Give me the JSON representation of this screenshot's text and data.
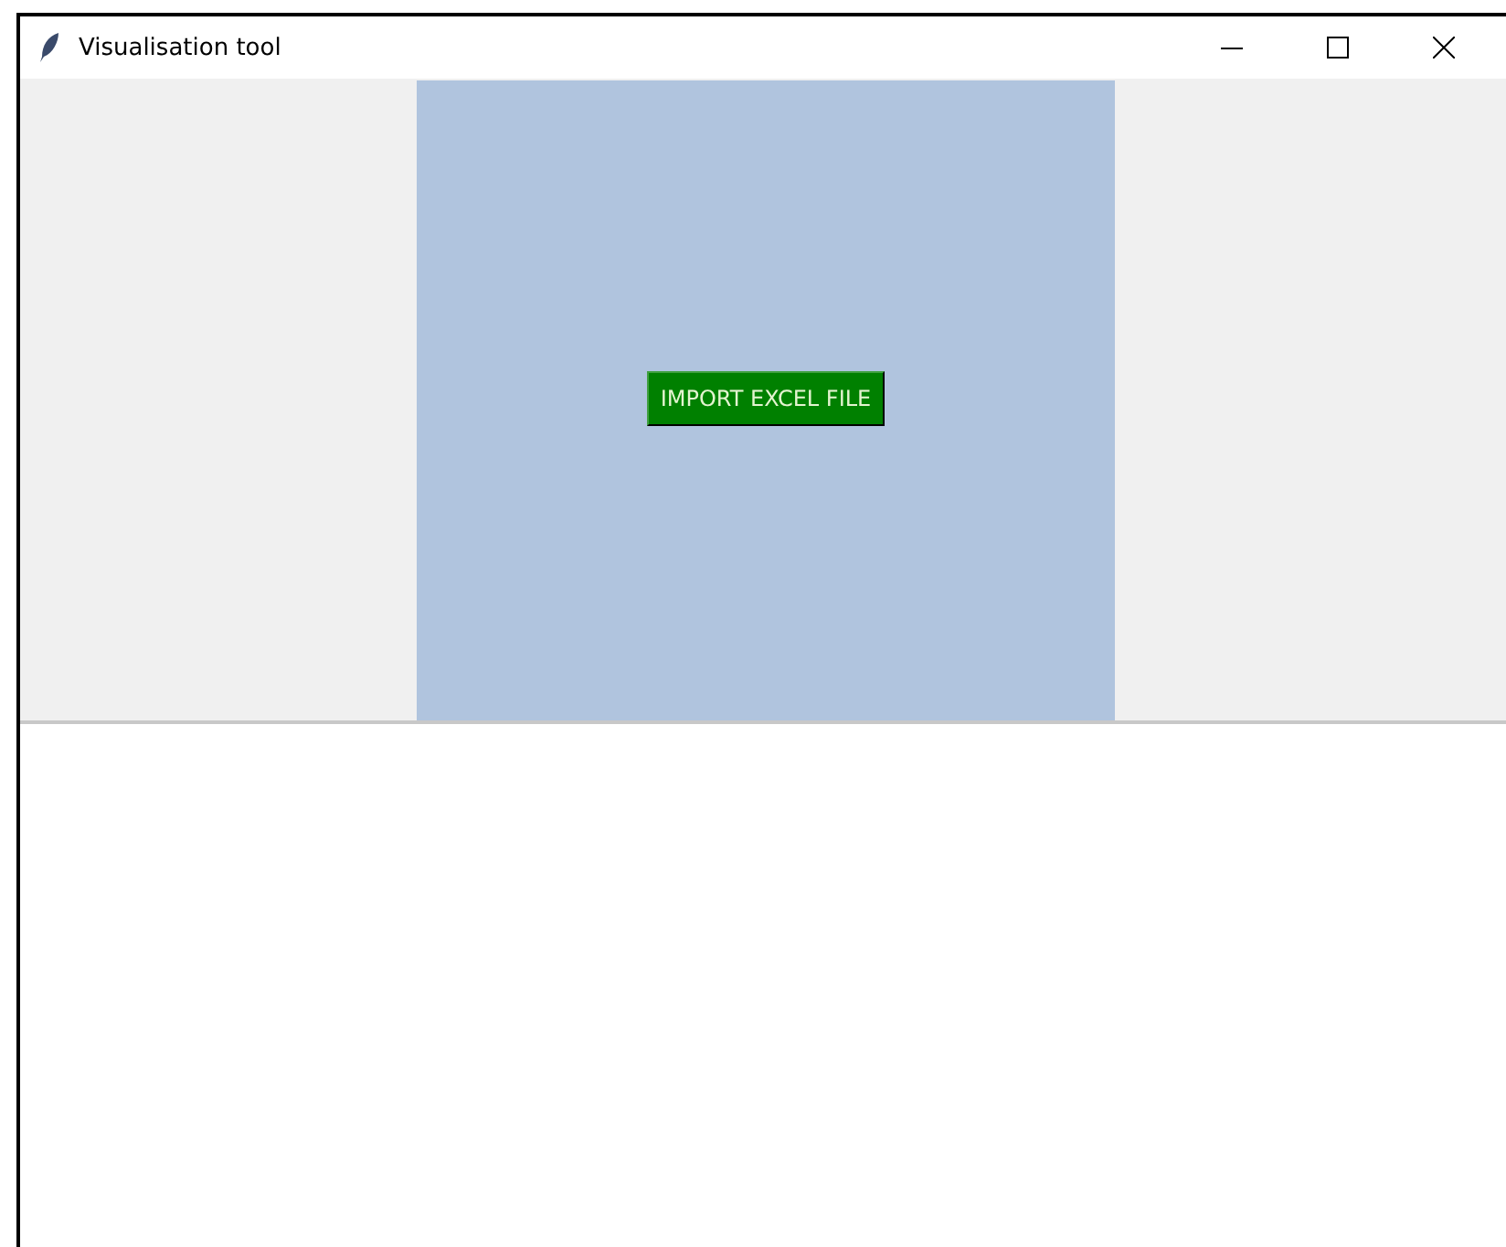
{
  "window": {
    "title": "Visualisation tool"
  },
  "import_button": {
    "label": "IMPORT EXCEL FILE"
  }
}
